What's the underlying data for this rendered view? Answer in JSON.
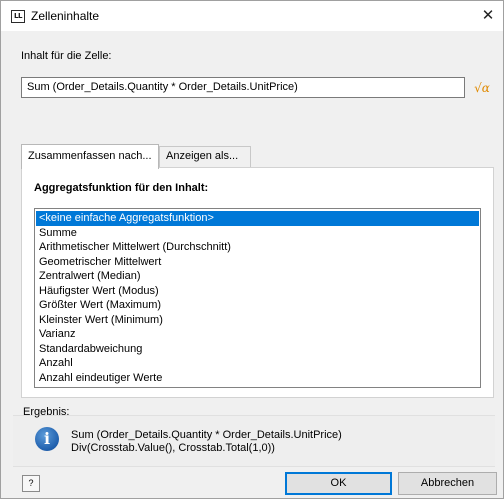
{
  "window": {
    "title": "Zelleninhalte",
    "app_icon_text": "LL",
    "close_glyph": "✕"
  },
  "content": {
    "label": "Inhalt für die Zelle:",
    "formula_value": "Sum (Order_Details.Quantity * Order_Details.UnitPrice)",
    "formula_button_glyph": "√α"
  },
  "tabs": [
    {
      "label": "Zusammenfassen nach..."
    },
    {
      "label": "Anzeigen als..."
    }
  ],
  "aggregate": {
    "title": "Aggregatsfunktion für den Inhalt:",
    "selected_index": 0,
    "items": [
      "<keine einfache Aggregatsfunktion>",
      "Summe",
      "Arithmetischer Mittelwert (Durchschnitt)",
      "Geometrischer Mittelwert",
      "Zentralwert (Median)",
      "Häufigster Wert (Modus)",
      "Größter Wert (Maximum)",
      "Kleinster Wert (Minimum)",
      "Varianz",
      "Standardabweichung",
      "Anzahl",
      "Anzahl eindeutiger Werte"
    ]
  },
  "result": {
    "label": "Ergebnis:",
    "icon_glyph": "i",
    "line1": "Sum (Order_Details.Quantity * Order_Details.UnitPrice)",
    "line2": "Div(Crosstab.Value(), Crosstab.Total(1,0))"
  },
  "footer": {
    "help_glyph": "?",
    "ok_label": "OK",
    "cancel_label": "Abbrechen"
  },
  "colors": {
    "selection": "#0078d7",
    "formula_icon": "#e08a00",
    "info_icon": "#1f5fad"
  }
}
